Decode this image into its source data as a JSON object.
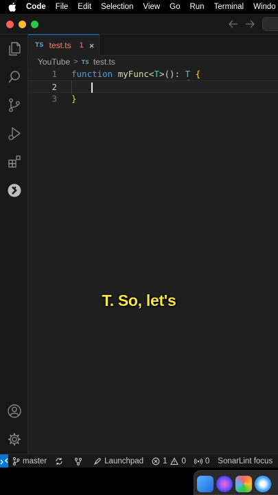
{
  "menubar": {
    "app": "Code",
    "items": [
      "File",
      "Edit",
      "Selection",
      "View",
      "Go",
      "Run",
      "Terminal",
      "Windo"
    ]
  },
  "tab": {
    "badge": "TS",
    "filename": "test.ts",
    "problem_count": "1",
    "close": "×"
  },
  "breadcrumb": {
    "folder": "YouTube",
    "separator": ">",
    "badge": "TS",
    "file": "test.ts"
  },
  "editor": {
    "lines": [
      {
        "number": "1"
      },
      {
        "number": "2"
      },
      {
        "number": "3"
      }
    ],
    "code": {
      "kw_function": "function",
      "fn_name": "myFunc",
      "lt": "<",
      "type_param": "T",
      "gt_paren": ">(): ",
      "return_type": "T",
      "open_brace": "{",
      "close_brace": "}"
    }
  },
  "caption": "T. So, let's",
  "statusbar": {
    "branch": "master",
    "launchpad": "Launchpad",
    "errors": "1",
    "warnings": "0",
    "ports": "0",
    "sonarlint": "SonarLint focus"
  },
  "colors": {
    "accent": "#0078d4",
    "keyword": "#569cd6",
    "function": "#dcdcaa",
    "type": "#4ec9b0",
    "bracket": "#ffd700",
    "tab_error": "#f88070",
    "caption": "#f5e642"
  }
}
